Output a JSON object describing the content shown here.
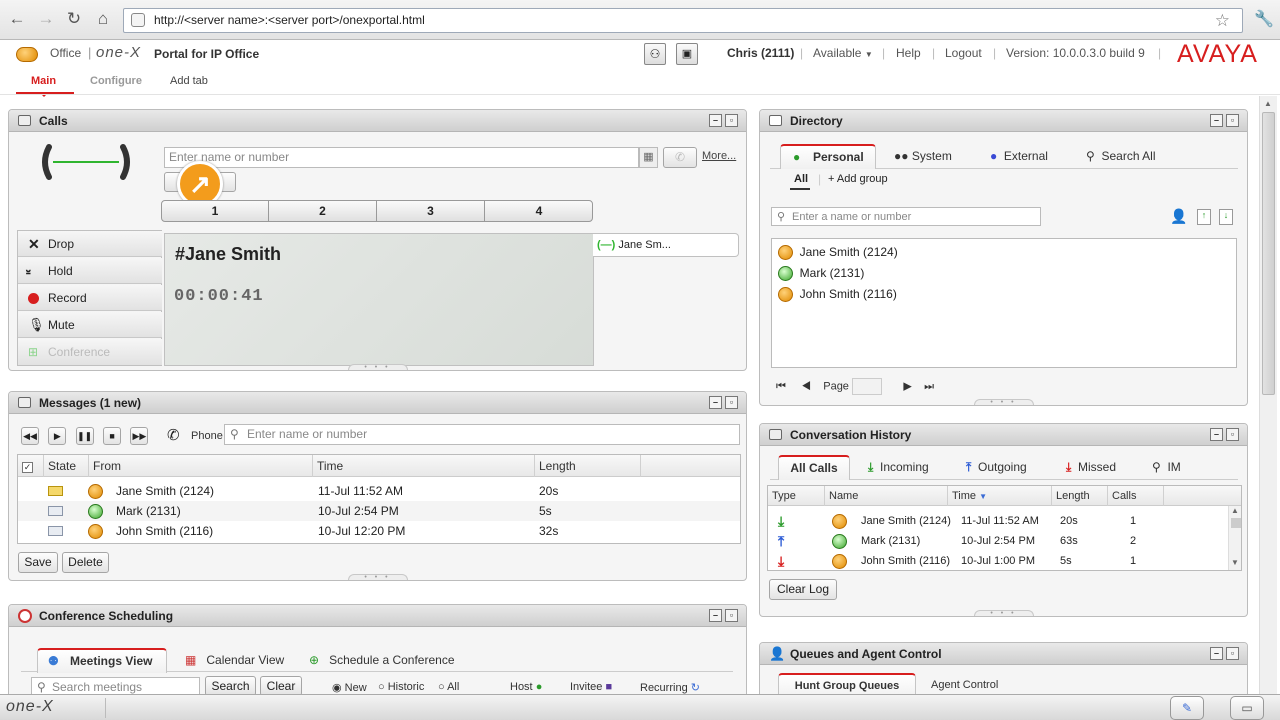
{
  "browser": {
    "url": "http://<server name>:<server port>/onexportal.html"
  },
  "header": {
    "office_label": "Office",
    "brand": "one-X",
    "portal_title": "Portal for IP Office",
    "user": "Chris (2111)",
    "status": "Available",
    "help": "Help",
    "logout": "Logout",
    "version": "Version: 10.0.0.3.0 build 9",
    "logo": "AVAYA"
  },
  "tabs": {
    "main": "Main",
    "configure": "Configure",
    "add_tab": "Add tab"
  },
  "calls": {
    "title": "Calls",
    "input_placeholder": "Enter name or number",
    "more": "More...",
    "lines": [
      "1",
      "2",
      "3",
      "4"
    ],
    "actions": {
      "drop": "Drop",
      "hold": "Hold",
      "record": "Record",
      "mute": "Mute",
      "conference": "Conference"
    },
    "active_name": "#Jane Smith",
    "timer": "00:00:41",
    "call_tab": "Jane Sm..."
  },
  "messages": {
    "title": "Messages (1 new)",
    "phone_label": "Phone",
    "search_placeholder": "Enter name or number",
    "columns": {
      "state": "State",
      "from": "From",
      "time": "Time",
      "length": "Length"
    },
    "rows": [
      {
        "from": "Jane Smith (2124)",
        "time": "11-Jul 11:52 AM",
        "length": "20s",
        "status": "orange"
      },
      {
        "from": "Mark (2131)",
        "time": "10-Jul 2:54 PM",
        "length": "5s",
        "status": "green"
      },
      {
        "from": "John Smith (2116)",
        "time": "10-Jul 12:20 PM",
        "length": "32s",
        "status": "orange"
      }
    ],
    "save": "Save",
    "delete": "Delete"
  },
  "conference": {
    "title": "Conference Scheduling",
    "tabs": {
      "meetings": "Meetings View",
      "calendar": "Calendar View",
      "schedule": "Schedule a Conference"
    },
    "search_placeholder": "Search meetings",
    "search_btn": "Search",
    "clear_btn": "Clear",
    "radio_new": "New",
    "radio_historic": "Historic",
    "radio_all": "All",
    "host": "Host",
    "invitee": "Invitee",
    "recurring": "Recurring"
  },
  "directory": {
    "title": "Directory",
    "tabs": {
      "personal": "Personal",
      "system": "System",
      "external": "External",
      "search_all": "Search All"
    },
    "subtab_all": "All",
    "add_group": "Add group",
    "search_placeholder": "Enter a name or number",
    "contacts": [
      {
        "name": "Jane Smith (2124)",
        "status": "orange"
      },
      {
        "name": "Mark (2131)",
        "status": "green"
      },
      {
        "name": "John Smith (2116)",
        "status": "orange"
      }
    ],
    "page_label": "Page"
  },
  "history": {
    "title": "Conversation History",
    "tabs": {
      "all": "All Calls",
      "incoming": "Incoming",
      "outgoing": "Outgoing",
      "missed": "Missed",
      "im": "IM"
    },
    "columns": {
      "type": "Type",
      "name": "Name",
      "time": "Time",
      "length": "Length",
      "calls": "Calls"
    },
    "rows": [
      {
        "type": "incoming",
        "name": "Jane Smith (2124)",
        "time": "11-Jul 11:52 AM",
        "length": "20s",
        "calls": "1",
        "status": "orange"
      },
      {
        "type": "outgoing",
        "name": "Mark (2131)",
        "time": "10-Jul 2:54 PM",
        "length": "63s",
        "calls": "2",
        "status": "green"
      },
      {
        "type": "missed",
        "name": "John Smith (2116)",
        "time": "10-Jul 1:00 PM",
        "length": "5s",
        "calls": "1",
        "status": "orange"
      }
    ],
    "clear_log": "Clear Log"
  },
  "queues": {
    "title": "Queues and Agent Control",
    "tabs": {
      "hunt": "Hunt Group Queues",
      "agent": "Agent Control"
    }
  },
  "taskbar": {
    "brand": "one-X"
  },
  "colors": {
    "accent": "#d71e1e",
    "presence_orange": "#e08a00",
    "presence_green": "#3aa52a"
  }
}
